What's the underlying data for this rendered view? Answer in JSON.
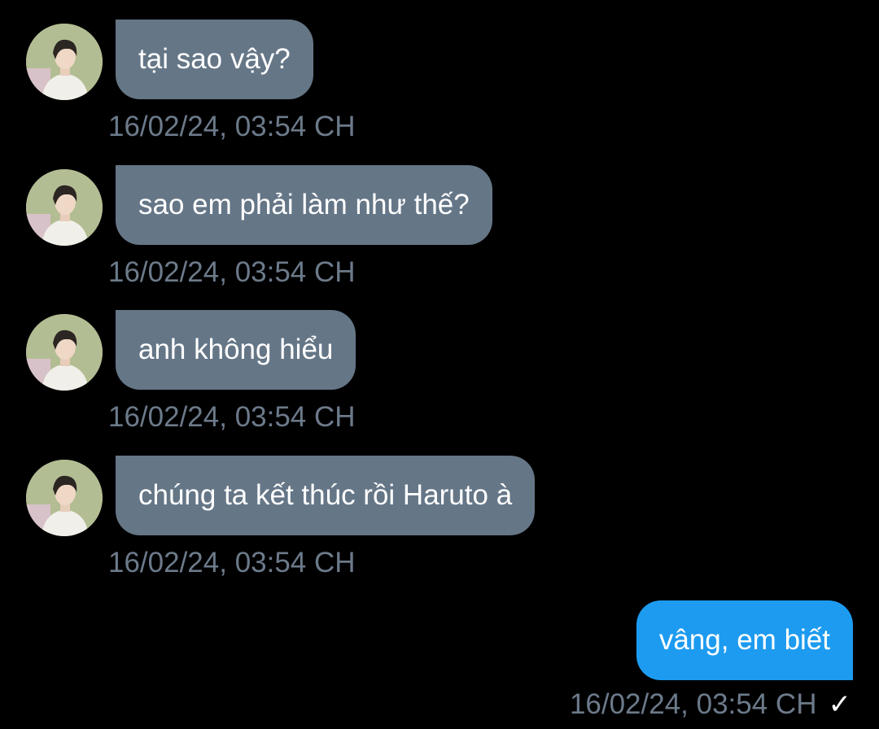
{
  "messages_incoming": [
    {
      "text": "tại sao vậy?",
      "timestamp": "16/02/24, 03:54 CH"
    },
    {
      "text": "sao em phải làm như thế?",
      "timestamp": "16/02/24, 03:54 CH"
    },
    {
      "text": "anh không hiểu",
      "timestamp": "16/02/24, 03:54 CH"
    },
    {
      "text": "chúng ta kết thúc rồi Haruto à",
      "timestamp": "16/02/24, 03:54 CH"
    }
  ],
  "message_outgoing": {
    "text": "vâng, em biết",
    "timestamp": "16/02/24, 03:54 CH",
    "status_icon": "check-icon",
    "status_glyph": "✓"
  },
  "colors": {
    "background": "#000000",
    "incoming_bubble": "#657687",
    "outgoing_bubble": "#1d9bf0",
    "timestamp": "#6c7a8a"
  }
}
